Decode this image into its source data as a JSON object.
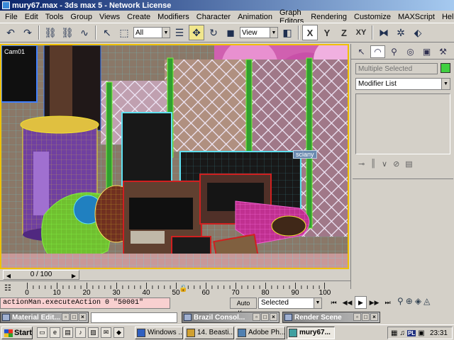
{
  "window": {
    "title": "mury67.max - 3ds max 5 - Network License"
  },
  "menu": {
    "items": [
      "File",
      "Edit",
      "Tools",
      "Group",
      "Views",
      "Create",
      "Modifiers",
      "Character",
      "Animation",
      "Graph Editors",
      "Rendering",
      "Customize",
      "MAXScript",
      "Help"
    ]
  },
  "toolbar": {
    "selection_filter": "All",
    "ref_coord": "View",
    "axes": {
      "x": "X",
      "y": "Y",
      "z": "Z",
      "xy": "XY"
    }
  },
  "viewport": {
    "label": "Cam01",
    "object_tag": "sciany"
  },
  "command_panel": {
    "name_field": "Multiple Selected",
    "color": "#40d040",
    "modifier_list": "Modifier List"
  },
  "time_slider": {
    "position": "0 / 100"
  },
  "track_bar": {
    "ticks": [
      "0",
      "10",
      "20",
      "30",
      "40",
      "50",
      "60",
      "70",
      "80",
      "90",
      "100"
    ]
  },
  "status": {
    "script_line": "actionMan.executeAction 0 \"50001\"",
    "auto_key": "Auto Key",
    "key_filter": "Selected"
  },
  "minimized_windows": [
    {
      "title": "Material Edit..."
    },
    {
      "title": "Brazil Consol..."
    },
    {
      "title": "Render Scene"
    }
  ],
  "taskbar": {
    "start": "Start",
    "buttons": [
      {
        "label": "Windows ...",
        "active": false
      },
      {
        "label": "14. Beasti...",
        "active": false
      },
      {
        "label": "Adobe Ph...",
        "active": false
      },
      {
        "label": "mury67...",
        "active": true
      }
    ],
    "lang": "PL",
    "clock": "23:31"
  }
}
